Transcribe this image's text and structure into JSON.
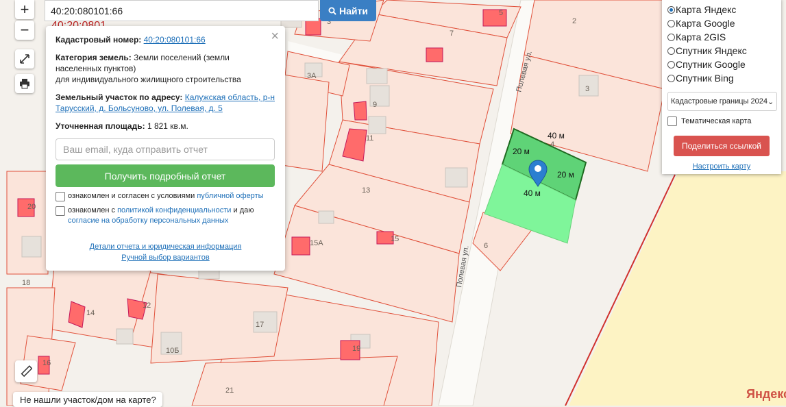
{
  "search": {
    "value": "40:20:080101:66",
    "button": "Найти"
  },
  "map_controls": {
    "zoom_in": "+",
    "zoom_out": "−"
  },
  "popup": {
    "cad_label": "Кадастровый номер:",
    "cad_value": "40:20:080101:66",
    "cat_label": "Категория земель:",
    "cat_value": "Земли поселений (земли населенных пунктов)",
    "cat_use": "для индивидуального жилищного строительства",
    "addr_label": "Земельный участок по адресу:",
    "addr_value": "Калужская область, р-н Тарусский, д. Больсуново, ул. Полевая, д. 5",
    "area_label": "Уточненная площадь:",
    "area_value": "1 821 кв.м.",
    "email_placeholder": "Ваш email, куда отправить отчет",
    "report_button": "Получить подробный отчет",
    "check1_text": "ознакомлен и согласен с условиями",
    "check1_link": "публичной оферты",
    "check2_text": "ознакомлен с",
    "check2_link": "политикой конфиденциальности",
    "check2_mid": "и даю",
    "check2_link2": "согласие на обработку персональных данных",
    "details_link": "Детали отчета и юридическая информация",
    "manual_link": "Ручной выбор вариантов",
    "close": "×"
  },
  "layers": {
    "options": [
      {
        "label": "Карта Яндекс",
        "selected": true
      },
      {
        "label": "Карта Google",
        "selected": false
      },
      {
        "label": "Карта 2GIS",
        "selected": false
      },
      {
        "label": "Спутник Яндекс",
        "selected": false
      },
      {
        "label": "Спутник Google",
        "selected": false
      },
      {
        "label": "Спутник Bing",
        "selected": false
      }
    ],
    "cadastral_select": "Кадастровые границы 2024",
    "thematic": "Тематическая карта",
    "share": "Поделиться ссылкой",
    "configure": "Настроить карту"
  },
  "notfound": "Не нашли участок/дом на карте?",
  "watermark": "Яндекс",
  "overlay_text": "40:20:0801",
  "street": "Полевая ул.",
  "plot_labels": {
    "l2": "2",
    "l3": "3",
    "l5": "5",
    "l7": "7",
    "l3a": "3А",
    "l9": "9",
    "l11": "11",
    "l13": "13",
    "l4": "4",
    "l6": "6",
    "l15a": "15А",
    "l15": "15",
    "l18": "18",
    "l14": "14",
    "l12": "12",
    "l10b": "10Б",
    "l17": "17",
    "l19": "19",
    "l16": "16",
    "l20": "20",
    "l21": "21",
    "l3top": "3"
  },
  "dimensions": {
    "top": "40 м",
    "left": "20 м",
    "right": "20 м",
    "bottom": "40 м"
  },
  "colors": {
    "plot_fill": "#fbe4da",
    "plot_border": "#e0503a",
    "selected_fill": "#7ff59a",
    "selected_dark": "#5fd377",
    "building": "#ff6b6b"
  }
}
